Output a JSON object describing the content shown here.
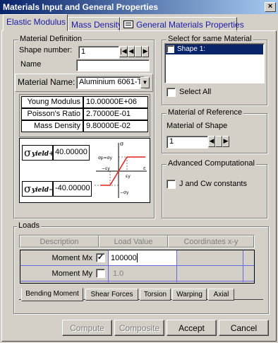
{
  "window": {
    "title": "Materials Input and General Properties",
    "close": "×"
  },
  "tabs": [
    {
      "label": "Elastic Modulus"
    },
    {
      "label": "Mass Density"
    },
    {
      "label": "General Materials Properties"
    }
  ],
  "material_definition": {
    "title": "Material Definition",
    "shape_number_label": "Shape number:",
    "shape_number_value": "1",
    "name_label": "Name",
    "name_value": "",
    "material_name_label": "Material Name:",
    "material_name_value": "Aluminium 6061-T",
    "properties": [
      {
        "label": "Young Modulus",
        "value": "10.00000E+06"
      },
      {
        "label": "Poisson's Ratio",
        "value": "2.70000E-01"
      },
      {
        "label": "Mass Density",
        "value": "9.80000E-02"
      }
    ],
    "yield_plus_symbol": "σ",
    "yield_plus_sub": "yield+",
    "yield_plus_value": "40.00000",
    "yield_minus_symbol": "σ",
    "yield_minus_sub": "yield−",
    "yield_minus_value": "-40.00000",
    "graph": {
      "sigma_axis": "σ",
      "sigma_p": "σp=σy",
      "minus_eps": "−εy",
      "eps_axis": "ε",
      "eps_y": "εy",
      "minus_sigma": "−σy"
    }
  },
  "same_material": {
    "title": "Select for same Material",
    "items": [
      {
        "label": "Shape 1:",
        "selected": true
      }
    ],
    "select_all_label": "Select All"
  },
  "reference": {
    "title": "Material of Reference",
    "shape_label": "Material of Shape",
    "shape_value": "1"
  },
  "advanced": {
    "title": "Advanced Computational",
    "jcw_label": "J and Cw constants"
  },
  "loads": {
    "title": "Loads",
    "headers": [
      "Description",
      "Load Value",
      "Coordinates x-y"
    ],
    "rows": [
      {
        "label": "Moment Mx",
        "checked": true,
        "value": "100000"
      },
      {
        "label": "Moment My",
        "checked": false,
        "value": "1.0"
      }
    ],
    "subtabs": [
      "Bending Moment",
      "Shear Forces",
      "Torsion",
      "Warping",
      "Axial"
    ]
  },
  "buttons": {
    "compute": "Compute",
    "composite": "Composite",
    "accept": "Accept",
    "cancel": "Cancel"
  },
  "colors": {
    "titlebar": "#0a246a",
    "selection": "#0a246a",
    "face": "#d4d0c8",
    "tab_text": "#1a1aa8",
    "graph_line": "#e02020"
  }
}
